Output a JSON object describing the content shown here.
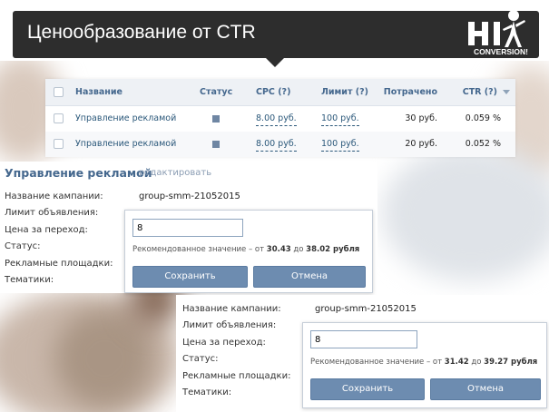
{
  "banner": {
    "title": "Ценообразование от CTR",
    "logo_text": "CONVERSION!"
  },
  "table": {
    "columns": [
      "Название",
      "Статус",
      "CPC (?)",
      "Лимит (?)",
      "Потрачено",
      "CTR (?)"
    ],
    "rows": [
      {
        "name": "Управление рекламой",
        "cpc": "8.00 руб.",
        "limit": "100 руб.",
        "spent": "30 руб.",
        "ctr": "0.059 %"
      },
      {
        "name": "Управление рекламой",
        "cpc": "8.00 руб.",
        "limit": "100 руб.",
        "spent": "20 руб.",
        "ctr": "0.052 %"
      }
    ]
  },
  "editor": {
    "title": "Управление рекламой",
    "edit_link": "редактировать",
    "labels": {
      "campaign": "Название кампании:",
      "limit": "Лимит объявления:",
      "price": "Цена за переход:",
      "status": "Статус:",
      "platforms": "Рекламные площадки:",
      "topics": "Тематики:"
    },
    "campaign_value": "group-smm-21052015"
  },
  "popup1": {
    "input_value": "8",
    "rec_prefix": "Рекомендованное значение – от",
    "rec_from": "30.43",
    "rec_mid": "до",
    "rec_to": "38.02 рубля",
    "save": "Сохранить",
    "cancel": "Отмена"
  },
  "popup2": {
    "input_value": "8",
    "rec_prefix": "Рекомендованное значение – от",
    "rec_from": "31.42",
    "rec_mid": "до",
    "rec_to": "39.27 рубля",
    "save": "Сохранить",
    "cancel": "Отмена"
  },
  "colors": {
    "banner": "#2d2d2d",
    "accent": "#45688e",
    "button": "#6d8cb0"
  }
}
